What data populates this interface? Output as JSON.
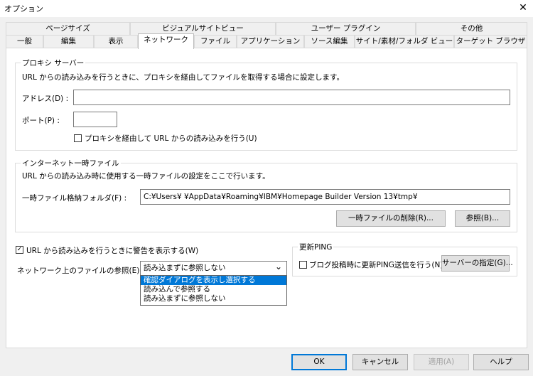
{
  "window": {
    "title": "オプション",
    "close": "✕"
  },
  "tabs_row1": [
    "ページサイズ",
    "ビジュアルサイトビュー",
    "ユーザー プラグイン",
    "その他"
  ],
  "tabs_row2": [
    "一般",
    "編集",
    "表示",
    "ネットワーク",
    "ファイル",
    "アプリケーション",
    "ソース編集",
    "サイト/素材/フォルダ ビュー",
    "ターゲット ブラウザ"
  ],
  "proxy": {
    "legend": "プロキシ サーバー",
    "description": "URL からの読み込みを行うときに、プロキシを経由してファイルを取得する場合に設定します。",
    "address_label": "アドレス(D) :",
    "address_value": "",
    "port_label": "ポート(P) :",
    "port_value": "",
    "use_proxy_label": "プロキシを経由して URL からの読み込みを行う(U)",
    "use_proxy_checked": false
  },
  "temp": {
    "legend": "インターネット一時ファイル",
    "description": "URL からの読み込み時に使用する一時ファイルの設定をここで行います。",
    "folder_label": "一時ファイル格納フォルダ(F) :",
    "folder_value": "C:¥Users¥        ¥AppData¥Roaming¥IBM¥Homepage Builder Version 13¥tmp¥",
    "delete_button": "一時ファイルの削除(R)...",
    "browse_button": "参照(B)..."
  },
  "warn": {
    "label": "URL から読み込みを行うときに警告を表示する(W)",
    "checked": true,
    "check_glyph": "✓"
  },
  "network_ref": {
    "label": "ネットワーク上のファイルの参照(E):",
    "selected": "読み込まずに参照しない",
    "options": [
      "確認ダイアログを表示し選択する",
      "読み込んで参照する",
      "読み込まずに参照しない"
    ],
    "highlighted_index": 0,
    "arrow": "⌄"
  },
  "ping": {
    "legend": "更新PING",
    "send_label": "ブログ投稿時に更新PING送信を行う(N)",
    "send_checked": false,
    "server_button": "サーバーの指定(G)..."
  },
  "footer": {
    "ok": "OK",
    "cancel": "キャンセル",
    "apply": "適用(A)",
    "help": "ヘルプ"
  }
}
